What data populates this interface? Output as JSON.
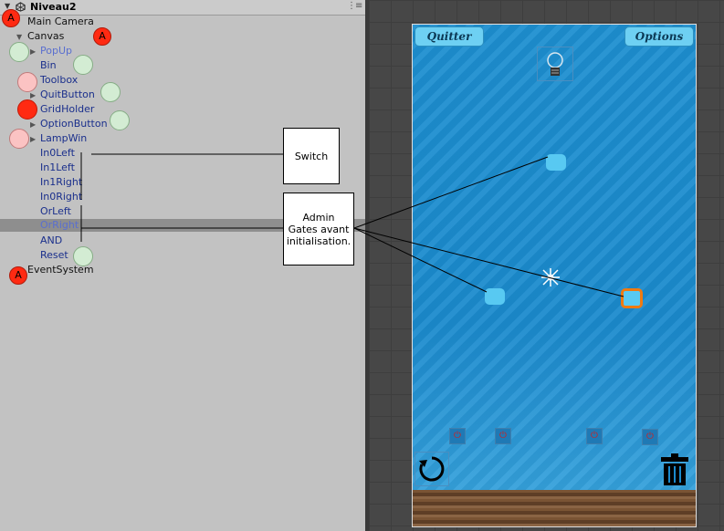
{
  "hierarchy": {
    "scene_name": "Niveau2",
    "menu_glyph": "⋮≡",
    "items": [
      {
        "label": "Main Camera",
        "indent": 0
      },
      {
        "label": "Canvas",
        "indent": 0
      },
      {
        "label": "PopUp",
        "indent": 1
      },
      {
        "label": "Bin",
        "indent": 1
      },
      {
        "label": "Toolbox",
        "indent": 1
      },
      {
        "label": "QuitButton",
        "indent": 1
      },
      {
        "label": "GridHolder",
        "indent": 1
      },
      {
        "label": "OptionButton",
        "indent": 1
      },
      {
        "label": "LampWin",
        "indent": 1
      },
      {
        "label": "In0Left",
        "indent": 1
      },
      {
        "label": "In1Left",
        "indent": 1
      },
      {
        "label": "In1Right",
        "indent": 1
      },
      {
        "label": "In0Right",
        "indent": 1
      },
      {
        "label": "OrLeft",
        "indent": 1
      },
      {
        "label": "OrRight",
        "indent": 1
      },
      {
        "label": "AND",
        "indent": 1
      },
      {
        "label": "Reset",
        "indent": 1
      },
      {
        "label": "EventSystem",
        "indent": 0
      }
    ],
    "marker_letter": "A"
  },
  "annotations": {
    "switch_label": "Switch",
    "admin_label": "Admin Gates avant initialisation."
  },
  "game": {
    "quit_label": "Quitter",
    "options_label": "Options",
    "power_glyph": "⏻"
  },
  "colors": {
    "marker_red": "#ff2a12",
    "marker_green": "#d3ecd3",
    "marker_pink": "#fbc3c3",
    "water_blue": "#1b8acd",
    "slot_cyan": "#58c9f2",
    "selected_orange": "#f07a10"
  }
}
